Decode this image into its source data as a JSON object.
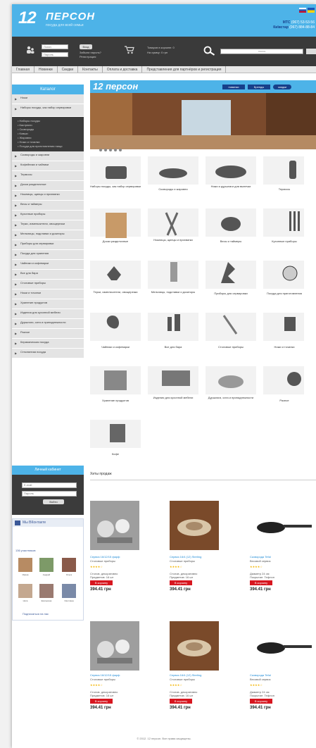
{
  "header": {
    "logo_number": "12",
    "logo_name": "ПЕРСОН",
    "tagline": "посуда для всей семьи",
    "phone_label_1": "MTC",
    "phone_1": "(067) 53-53-56",
    "phone_label_2": "Київстар",
    "phone_2": "(067) 884-88-84",
    "flag_colors": [
      "#c8102e",
      "#1a53b8",
      "#ffd500"
    ]
  },
  "userbar": {
    "login_placeholder": "Логин",
    "password_placeholder": "Пароль",
    "login_button": "Вход",
    "register_link": "Забыли пароль?",
    "register_link_2": "Регистрация",
    "cart_line_1": "Товаров в корзине: 0",
    "cart_line_2": "На сумму: 0 грн",
    "search_placeholder": "поиск",
    "search_button": "Найти"
  },
  "nav": [
    "Главная",
    "Новинки",
    "Скидки",
    "Контакты",
    "Оплата и доставка",
    "Представления для партнёров и регистрация"
  ],
  "sidebar": {
    "title": "Каталог",
    "categories_top": [
      "Ножи",
      "Наборы посуды, как набор сервировки"
    ],
    "subcategories": [
      "Наборы посуды",
      "Кастрюли",
      "Сковороды",
      "Ковши",
      "Жаровни",
      "Ножи и точилки",
      "Посуда для приготовления пищи"
    ],
    "categories": [
      "Сковороды и жаровни",
      "Кофейники и чайники",
      "Термосы",
      "Доски разделочные",
      "Ножницы, щипцы и прихватки",
      "Весы и таймеры",
      "Кухонные приборы",
      "Терки, измельчители, овощерезки",
      "Мельницы, подставки и дозаторы",
      "Приборы для сервировки",
      "Посуда для хранения",
      "Чайники и кофеварки",
      "Все для бара",
      "Столовые приборы",
      "Ножи и точилки",
      "Хранение продуктов",
      "Изделия для кухонной мебели",
      "Дуршлаги, сита и принадлежности",
      "Разное",
      "Керамическая посуда",
      "Стеклянная посуда"
    ]
  },
  "login_box": {
    "title": "Личный кабинет",
    "email_placeholder": "E-mail",
    "pass_placeholder": "Пароль",
    "submit": "Войти"
  },
  "social": {
    "title": "Мы ВКонтакте",
    "members_label": "136 участников",
    "members": [
      "Ирина",
      "Андрей",
      "Ольга",
      "Ната",
      "Екатерина",
      "Светлана"
    ],
    "join_label": "Подписаться на нас"
  },
  "banner": {
    "logo": "12 персон",
    "pill_1": "новинки",
    "pill_2": "Бренды",
    "pill_3": "скидки"
  },
  "tiles": [
    "Наборы посуды, как набор сервировки",
    "Сковороды и жаровни",
    "Ножи и дуршлаги для выпечки",
    "Термосы",
    "Доски разделочные",
    "Ножницы, щипцы и прихватки",
    "Весы и таймеры",
    "Кухонные приборы",
    "Терки, измельчители, овощерезки",
    "Мельницы, подставки и дозаторы",
    "Приборы для сервировки",
    "Посуда для приготовления",
    "Чайники и кофеварки",
    "Все для бара",
    "Столовые приборы",
    "Ножи и точилки",
    "Хранение продуктов",
    "Изделия для кухонной мебели",
    "Дуршлаги, сита и принадлежности",
    "Разное",
    "Кофе"
  ],
  "hits_title": "Хиты продаж",
  "products": [
    {
      "name": "Сервиз 16/12/15 фарф",
      "sub": "Столовые приборы",
      "meta1": "Столов. декоративно",
      "meta2": "Предметов: 16 шт",
      "buy": "В корзину",
      "price": "394.41 грн"
    },
    {
      "name": "Сервиз 16/4 (12) Sterling",
      "sub": "Столовые приборы",
      "meta1": "Столов. декоративно",
      "meta2": "Предметов: 16 шт",
      "buy": "В корзину",
      "price": "394.41 грн"
    },
    {
      "name": "Сковорода Tefal",
      "sub": "Весовой сервиз",
      "meta1": "Диаметр 24 см",
      "meta2": "Покрытие: Тефлон",
      "buy": "В корзину",
      "price": "394.41 грн"
    },
    {
      "name": "Сервиз 16/12/15 фарф",
      "sub": "Столовые приборы",
      "meta1": "Столов. декоративно",
      "meta2": "Предметов: 16 шт",
      "buy": "В корзину",
      "price": "394.41 грн"
    },
    {
      "name": "Сервиз 16/4 (12) Sterling",
      "sub": "Столовые приборы",
      "meta1": "Столов. декоративно",
      "meta2": "Предметов: 16 шт",
      "buy": "В корзину",
      "price": "394.41 грн"
    },
    {
      "name": "Сковорода Tefal",
      "sub": "Весовой сервиз",
      "meta1": "Диаметр 24 см",
      "meta2": "Покрытие: Тефлон",
      "buy": "В корзину",
      "price": "394.41 грн"
    }
  ],
  "footer": "© 2012. 12 персон. Все права защищены."
}
